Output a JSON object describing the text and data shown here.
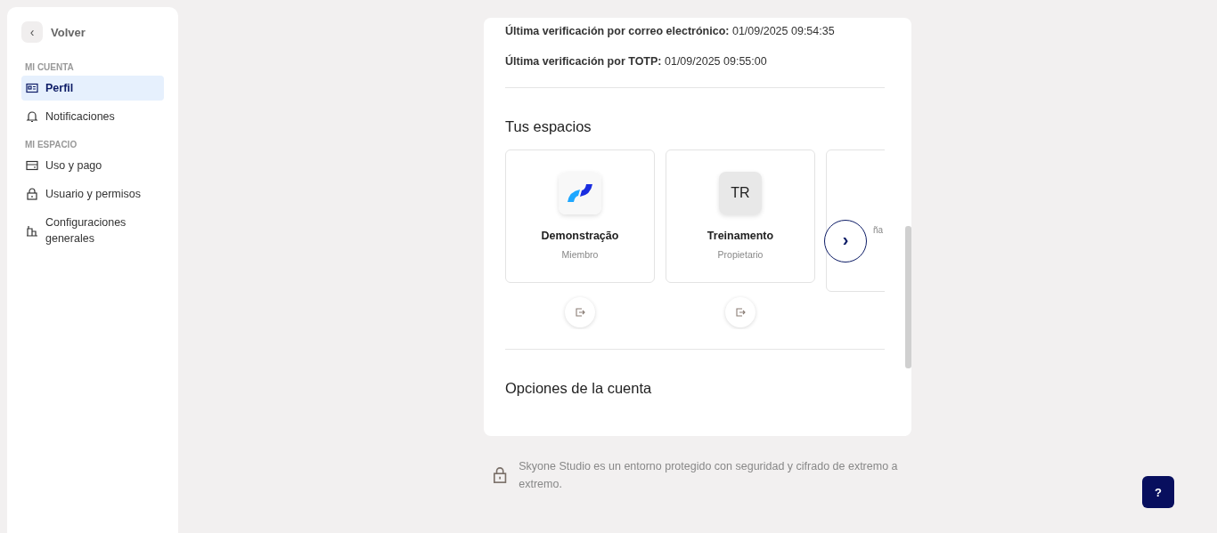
{
  "sidebar": {
    "back": {
      "icon": "‹",
      "label": "Volver"
    },
    "sections": [
      {
        "title": "MI CUENTA",
        "items": [
          {
            "label": "Perfil",
            "selected": true
          },
          {
            "label": "Notificaciones",
            "selected": false
          }
        ]
      },
      {
        "title": "MI ESPACIO",
        "items": [
          {
            "label": "Uso y pago",
            "selected": false
          },
          {
            "label": "Usuario y permisos",
            "selected": false
          },
          {
            "label": "Configuraciones generales",
            "selected": false
          }
        ]
      }
    ]
  },
  "verification": [
    {
      "label": "Última verificación por correo electrónico:",
      "value": "01/09/2025 09:54:35"
    },
    {
      "label": "Última verificación por TOTP:",
      "value": "01/09/2025 09:55:00"
    }
  ],
  "spaces": {
    "title": "Tus espacios",
    "items": [
      {
        "kind": "logo",
        "name": "Demonstração",
        "role": "Miembro"
      },
      {
        "kind": "initials",
        "initials": "TR",
        "name": "Treinamento",
        "role": "Propietario"
      }
    ],
    "partial_name": "ña",
    "next": "›"
  },
  "account_options": {
    "title": "Opciones de la cuenta"
  },
  "security_note": "Skyone Studio es un entorno protegido con seguridad y cifrado de extremo a extremo.",
  "help": "?"
}
